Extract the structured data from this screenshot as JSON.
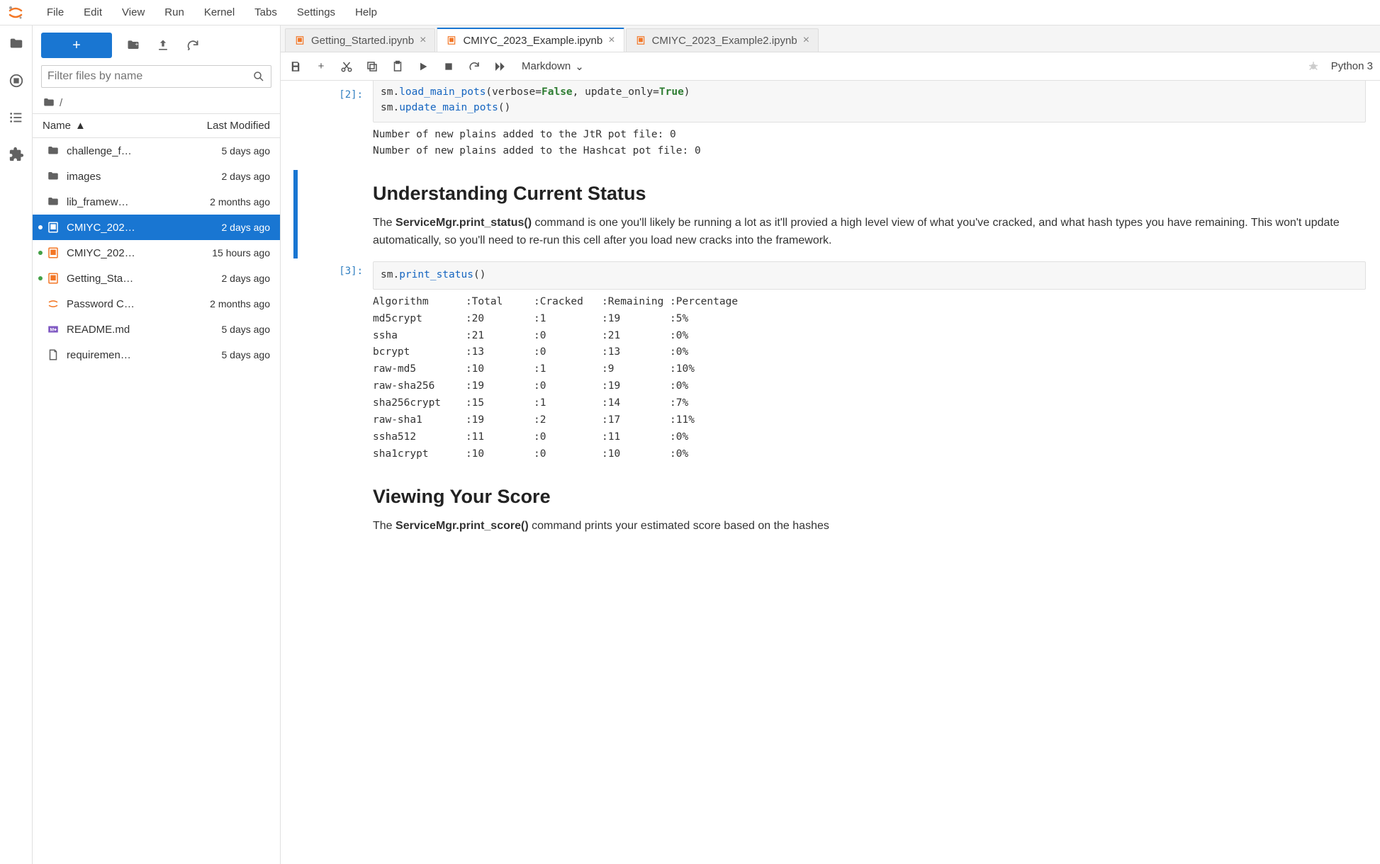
{
  "menu": {
    "items": [
      "File",
      "Edit",
      "View",
      "Run",
      "Kernel",
      "Tabs",
      "Settings",
      "Help"
    ]
  },
  "fb": {
    "filter_placeholder": "Filter files by name",
    "crumb": "/",
    "header": {
      "name": "Name",
      "modified": "Last Modified"
    },
    "rows": [
      {
        "icon": "folder",
        "name": "challenge_f…",
        "modified": "5 days ago"
      },
      {
        "icon": "folder",
        "name": "images",
        "modified": "2 days ago"
      },
      {
        "icon": "folder",
        "name": "lib_framew…",
        "modified": "2 months ago"
      },
      {
        "icon": "notebook",
        "name": "CMIYC_202…",
        "modified": "2 days ago",
        "selected": true,
        "dot": "grey"
      },
      {
        "icon": "notebook",
        "name": "CMIYC_202…",
        "modified": "15 hours ago",
        "dot": "green"
      },
      {
        "icon": "notebook",
        "name": "Getting_Sta…",
        "modified": "2 days ago",
        "dot": "green"
      },
      {
        "icon": "jupyter",
        "name": "Password C…",
        "modified": "2 months ago"
      },
      {
        "icon": "markdown",
        "name": "README.md",
        "modified": "5 days ago"
      },
      {
        "icon": "file",
        "name": "requiremen…",
        "modified": "5 days ago"
      }
    ]
  },
  "tabs": [
    {
      "label": "Getting_Started.ipynb",
      "active": false
    },
    {
      "label": "CMIYC_2023_Example.ipynb",
      "active": true
    },
    {
      "label": "CMIYC_2023_Example2.ipynb",
      "active": false
    }
  ],
  "toolbar": {
    "cell_type": "Markdown",
    "kernel": "Python 3"
  },
  "notebook": {
    "cell2_code_html": "sm.<span class='tok-func'>load_main_pots</span>(verbose=<span class='tok-kw'>False</span>, update_only=<span class='tok-kw'>True</span>)\nsm.<span class='tok-func'>update_main_pots</span>()",
    "cell2_output": "Number of new plains added to the JtR pot file: 0\nNumber of new plains added to the Hashcat pot file: 0",
    "md1_heading": "Understanding Current Status",
    "md1_body_pre": "The ",
    "md1_bold1": "ServiceMgr.print_status()",
    "md1_body_post": " command is one you'll likely be running a lot as it'll provied a high level view of what you've cracked, and what hash types you have remaining. This won't update automatically, so you'll need to re-run this cell after you load new cracks into the framework.",
    "cell3_prompt": "[3]:",
    "cell3_code_html": "sm.<span class='tok-func'>print_status</span>()",
    "cell3_output": "Algorithm      :Total     :Cracked   :Remaining :Percentage\nmd5crypt       :20        :1         :19        :5%\nssha           :21        :0         :21        :0%\nbcrypt         :13        :0         :13        :0%\nraw-md5        :10        :1         :9         :10%\nraw-sha256     :19        :0         :19        :0%\nsha256crypt    :15        :1         :14        :7%\nraw-sha1       :19        :2         :17        :11%\nssha512        :11        :0         :11        :0%\nsha1crypt      :10        :0         :10        :0%",
    "md2_heading": "Viewing Your Score",
    "md2_body_pre": "The ",
    "md2_bold1": "ServiceMgr.print_score()",
    "md2_body_post": " command prints your estimated score based on the hashes"
  }
}
